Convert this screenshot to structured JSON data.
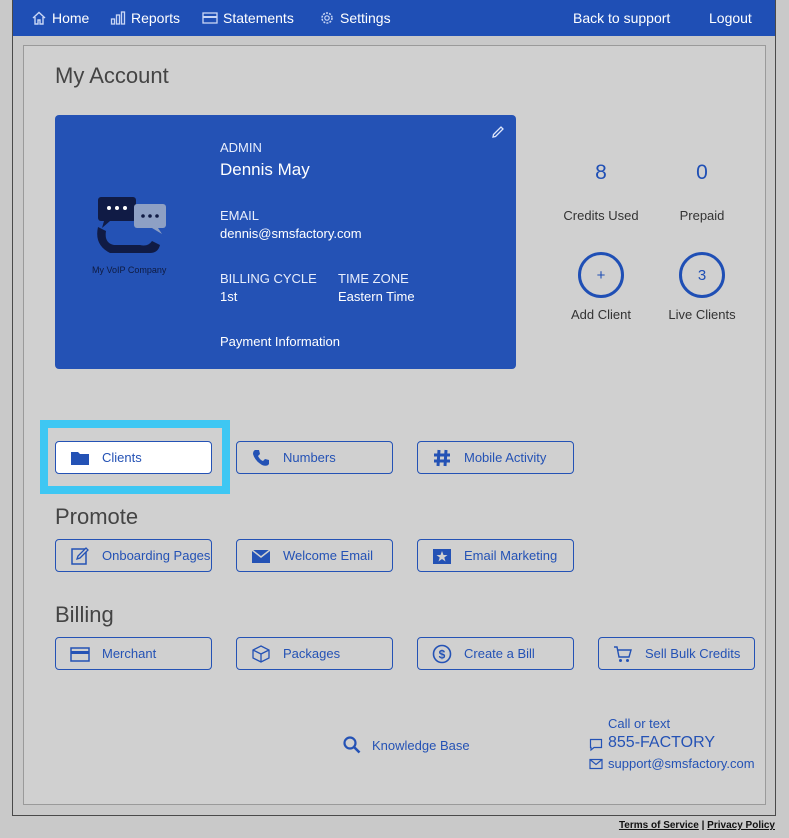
{
  "nav": {
    "home": "Home",
    "reports": "Reports",
    "statements": "Statements",
    "settings": "Settings",
    "back_to_support": "Back to support",
    "logout": "Logout"
  },
  "page_title": "My Account",
  "account": {
    "admin_label": "ADMIN",
    "admin_name": "Dennis May",
    "email_label": "EMAIL",
    "email": "dennis@smsfactory.com",
    "billing_cycle_label": "BILLING CYCLE",
    "billing_cycle": "1st",
    "time_zone_label": "TIME ZONE",
    "time_zone": "Eastern Time",
    "payment_information": "Payment Information",
    "logo_caption": "My VoIP Company"
  },
  "stats": {
    "credits_used_value": "8",
    "credits_used_label": "Credits Used",
    "prepaid_value": "0",
    "prepaid_label": "Prepaid",
    "add_client_symbol": "+",
    "add_client_label": "Add Client",
    "live_clients_value": "3",
    "live_clients_label": "Live Clients"
  },
  "manage_buttons": {
    "clients": "Clients",
    "numbers": "Numbers",
    "mobile_activity": "Mobile Activity"
  },
  "promote": {
    "title": "Promote",
    "onboarding_pages": "Onboarding Pages",
    "welcome_email": "Welcome Email",
    "email_marketing": "Email Marketing"
  },
  "billing": {
    "title": "Billing",
    "merchant": "Merchant",
    "packages": "Packages",
    "create_a_bill": "Create a Bill",
    "sell_bulk_credits": "Sell Bulk Credits"
  },
  "footer": {
    "knowledge_base": "Knowledge Base",
    "call_or_text": "Call or text",
    "phone": "855-FACTORY",
    "support_email": "support@smsfactory.com",
    "terms": "Terms of Service",
    "separator": "|",
    "privacy": "Privacy Policy"
  },
  "colors": {
    "nav_blue": "#1f4fb5",
    "card_blue": "#2452b5",
    "highlight": "#3ec7f3",
    "panel_bg": "#d0d0d0"
  }
}
